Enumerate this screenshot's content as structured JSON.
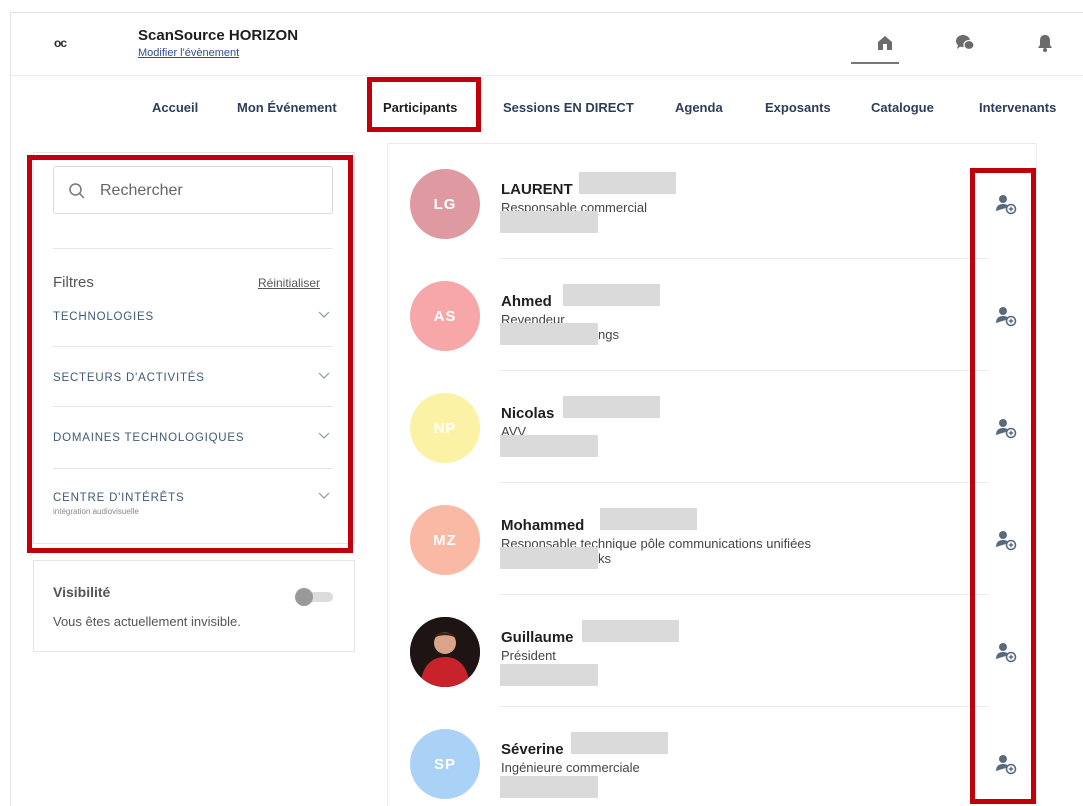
{
  "header": {
    "logo_text": "oc",
    "title": "ScanSource HORIZON",
    "subtitle_link": "Modifier l'évènement",
    "icons": [
      "home-icon",
      "chat-bubbles-icon",
      "bell-icon"
    ]
  },
  "nav": {
    "items": [
      {
        "label": "Accueil"
      },
      {
        "label": "Mon Événement"
      },
      {
        "label": "Participants",
        "active": true
      },
      {
        "label": "Sessions EN DIRECT"
      },
      {
        "label": "Agenda"
      },
      {
        "label": "Exposants"
      },
      {
        "label": "Catalogue"
      },
      {
        "label": "Intervenants"
      }
    ]
  },
  "search": {
    "placeholder": "Rechercher"
  },
  "filters": {
    "title": "Filtres",
    "reset_label": "Réinitialiser",
    "categories": [
      {
        "label": "TECHNOLOGIES"
      },
      {
        "label": "SECTEURS D'ACTIVITÉS"
      },
      {
        "label": "DOMAINES TECHNOLOGIQUES"
      },
      {
        "label": "CENTRE D'INTÉRÊTS",
        "selected": "intégration audiovisuelle"
      }
    ]
  },
  "visibility": {
    "title": "Visibilité",
    "status_text": "Vous êtes actuellement invisible.",
    "enabled": false
  },
  "participants": [
    {
      "initials": "LG",
      "name": "LAURENT",
      "job": "Responsable commercial",
      "extra": "",
      "color": "#de9aa0"
    },
    {
      "initials": "AS",
      "name": "Ahmed",
      "job": "Revendeur",
      "extra": "ngs",
      "color": "#f7a7a8"
    },
    {
      "initials": "NP",
      "name": "Nicolas",
      "job": "AVV",
      "extra": "",
      "color": "#fbf2a6"
    },
    {
      "initials": "MZ",
      "name": "Mohammed",
      "job": "Responsable technique pôle communications unifiées",
      "extra": "ks",
      "color": "#f9b9a4"
    },
    {
      "initials": "",
      "name": "Guillaume",
      "job": "Président",
      "extra": "",
      "color": "#2b1c1c",
      "photo": true
    },
    {
      "initials": "SP",
      "name": "Séverine",
      "job": "Ingénieure commerciale",
      "extra": "",
      "color": "#a9d2f6"
    }
  ],
  "colors": {
    "highlight": "#c0000a",
    "nav_text": "#2d3e5a",
    "link": "#2c4f8c"
  }
}
